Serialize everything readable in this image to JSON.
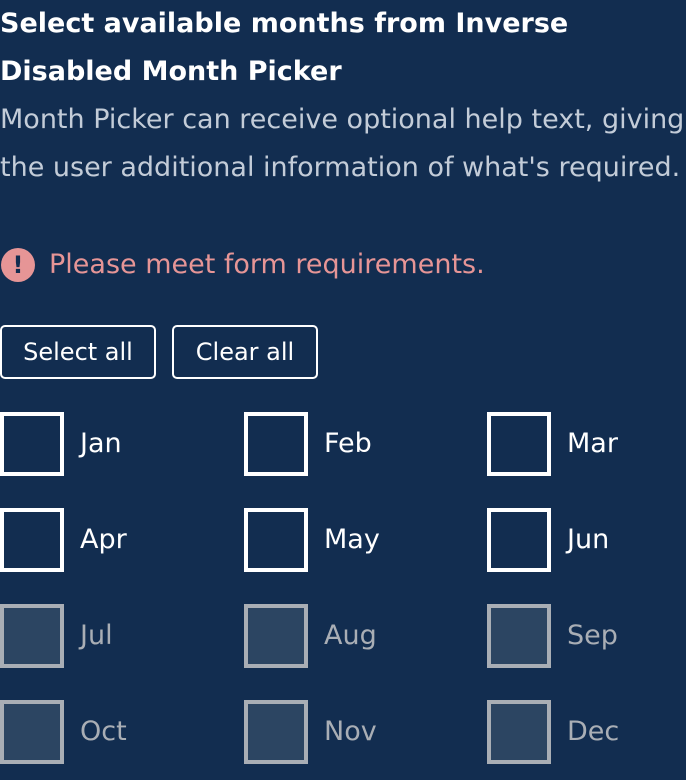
{
  "title": "Select available months from Inverse Disabled Month Picker",
  "help_text": "Month Picker can receive optional help text, giving the user additional information of what's required.",
  "error": {
    "icon": "exclamation-circle-icon",
    "text": "Please meet form requirements."
  },
  "buttons": {
    "select_all": "Select all",
    "clear_all": "Clear all"
  },
  "months": [
    {
      "label": "Jan",
      "checked": false,
      "disabled": false
    },
    {
      "label": "Feb",
      "checked": false,
      "disabled": false
    },
    {
      "label": "Mar",
      "checked": false,
      "disabled": false
    },
    {
      "label": "Apr",
      "checked": false,
      "disabled": false
    },
    {
      "label": "May",
      "checked": false,
      "disabled": false
    },
    {
      "label": "Jun",
      "checked": false,
      "disabled": false
    },
    {
      "label": "Jul",
      "checked": false,
      "disabled": true
    },
    {
      "label": "Aug",
      "checked": false,
      "disabled": true
    },
    {
      "label": "Sep",
      "checked": false,
      "disabled": true
    },
    {
      "label": "Oct",
      "checked": false,
      "disabled": true
    },
    {
      "label": "Nov",
      "checked": false,
      "disabled": true
    },
    {
      "label": "Dec",
      "checked": false,
      "disabled": true
    }
  ]
}
